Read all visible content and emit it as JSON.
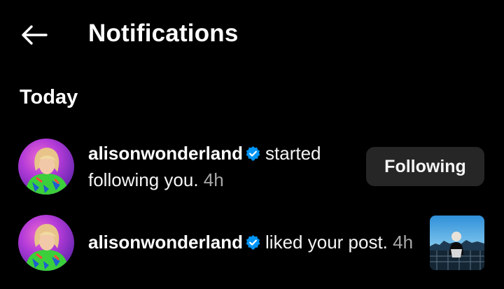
{
  "header": {
    "back_icon": "arrow-left-icon",
    "title": "Notifications"
  },
  "sections": [
    {
      "label": "Today"
    }
  ],
  "notifications": [
    {
      "username": "alisonwonderland",
      "verified_icon": "verified-badge-icon",
      "action": "started following you.",
      "time": "4h",
      "button_label": "Following"
    },
    {
      "username": "alisonwonderland",
      "verified_icon": "verified-badge-icon",
      "action": "liked your post.",
      "time": "4h"
    }
  ],
  "colors": {
    "background": "#000000",
    "text": "#ffffff",
    "secondary_text": "#a8a8a8",
    "verified_blue": "#0095f6",
    "button_bg": "#262626"
  }
}
